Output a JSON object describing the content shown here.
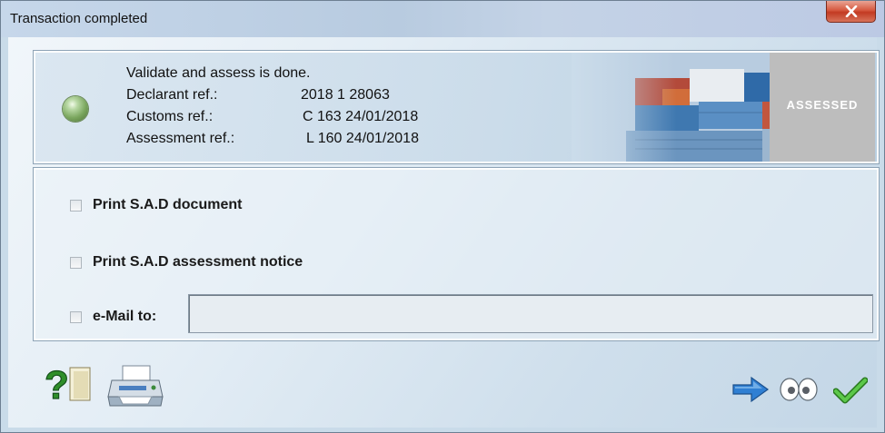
{
  "window": {
    "title": "Transaction completed"
  },
  "status": {
    "indicator_icon": "status-led-green",
    "message": "Validate and assess is done.",
    "declarant_ref_label": "Declarant ref.:",
    "declarant_ref_value": "2018 1 28063",
    "customs_ref_label": "Customs ref.:",
    "customs_ref_value": "C 163 24/01/2018",
    "assessment_ref_label": "Assessment ref.:",
    "assessment_ref_value": "L 160 24/01/2018",
    "badge": "ASSESSED"
  },
  "options": {
    "print_sad_document": {
      "label": "Print S.A.D document",
      "checked": false
    },
    "print_assessment_notice": {
      "label": "Print S.A.D assessment notice",
      "checked": false
    },
    "email": {
      "label": "e-Mail to:",
      "checked": false,
      "value": ""
    }
  },
  "toolbar": {
    "icons": [
      "help-icon",
      "printer-icon",
      "arrow-right-icon",
      "view-eyes-icon",
      "checkmark-icon"
    ]
  },
  "colors": {
    "close_button": "#c94b33",
    "arrow_blue": "#2f7fd3",
    "check_green": "#3aa62c",
    "help_green": "#2f8f2a"
  }
}
